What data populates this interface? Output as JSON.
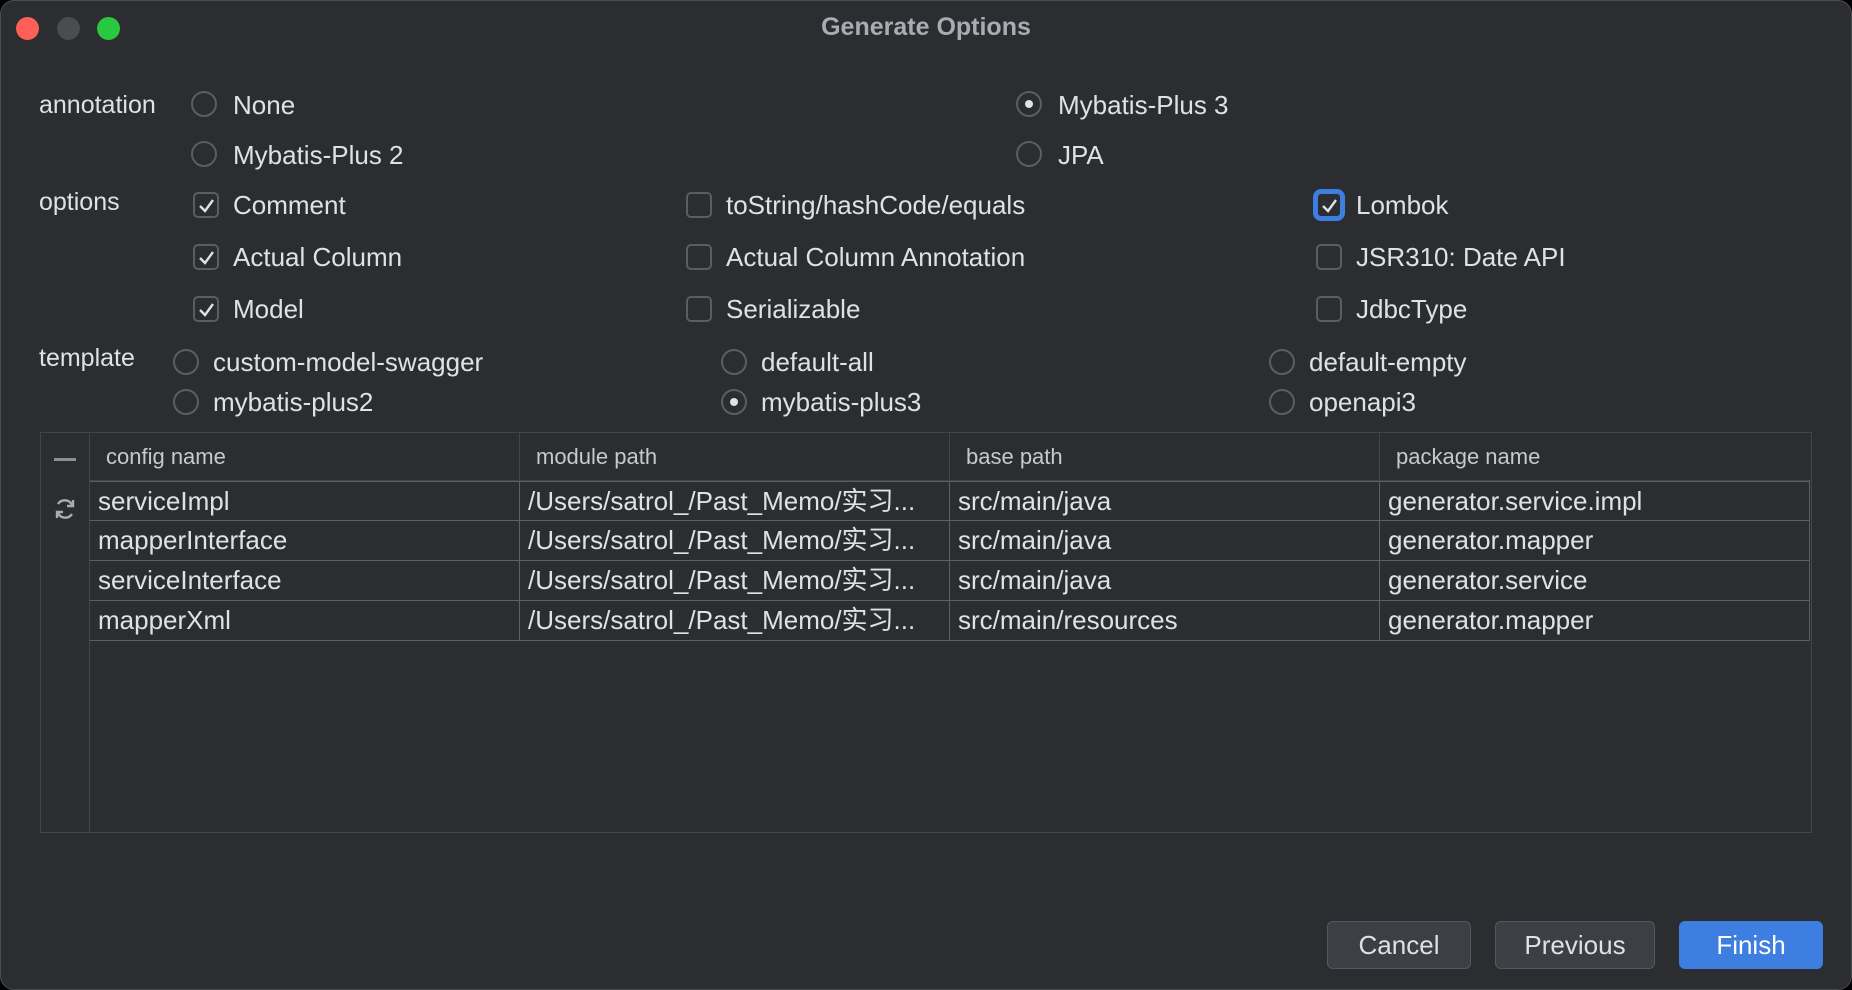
{
  "window": {
    "title": "Generate Options"
  },
  "annotation": {
    "label": "annotation",
    "options": [
      {
        "label": "None",
        "selected": false
      },
      {
        "label": "Mybatis-Plus 3",
        "selected": true
      },
      {
        "label": "Mybatis-Plus 2",
        "selected": false
      },
      {
        "label": "JPA",
        "selected": false
      }
    ]
  },
  "options": {
    "label": "options",
    "items": [
      {
        "label": "Comment",
        "checked": true
      },
      {
        "label": "toString/hashCode/equals",
        "checked": false
      },
      {
        "label": "Lombok",
        "checked": true,
        "focused": true
      },
      {
        "label": "Actual Column",
        "checked": true
      },
      {
        "label": "Actual Column Annotation",
        "checked": false
      },
      {
        "label": "JSR310: Date API",
        "checked": false
      },
      {
        "label": "Model",
        "checked": true
      },
      {
        "label": "Serializable",
        "checked": false
      },
      {
        "label": "JdbcType",
        "checked": false
      }
    ]
  },
  "template": {
    "label": "template",
    "options": [
      {
        "label": "custom-model-swagger",
        "selected": false
      },
      {
        "label": "default-all",
        "selected": false
      },
      {
        "label": "default-empty",
        "selected": false
      },
      {
        "label": "mybatis-plus2",
        "selected": false
      },
      {
        "label": "mybatis-plus3",
        "selected": true
      },
      {
        "label": "openapi3",
        "selected": false
      }
    ]
  },
  "table": {
    "columns": [
      "config name",
      "module path",
      "base path",
      "package name"
    ],
    "rows": [
      [
        "serviceImpl",
        "/Users/satrol_/Past_Memo/实习...",
        "src/main/java",
        "generator.service.impl"
      ],
      [
        "mapperInterface",
        "/Users/satrol_/Past_Memo/实习...",
        "src/main/java",
        "generator.mapper"
      ],
      [
        "serviceInterface",
        "/Users/satrol_/Past_Memo/实习...",
        "src/main/java",
        "generator.service"
      ],
      [
        "mapperXml",
        "/Users/satrol_/Past_Memo/实习...",
        "src/main/resources",
        "generator.mapper"
      ]
    ]
  },
  "buttons": {
    "cancel": "Cancel",
    "previous": "Previous",
    "finish": "Finish"
  },
  "colors": {
    "accent": "#3d7ee0",
    "background": "#2b2d30"
  }
}
